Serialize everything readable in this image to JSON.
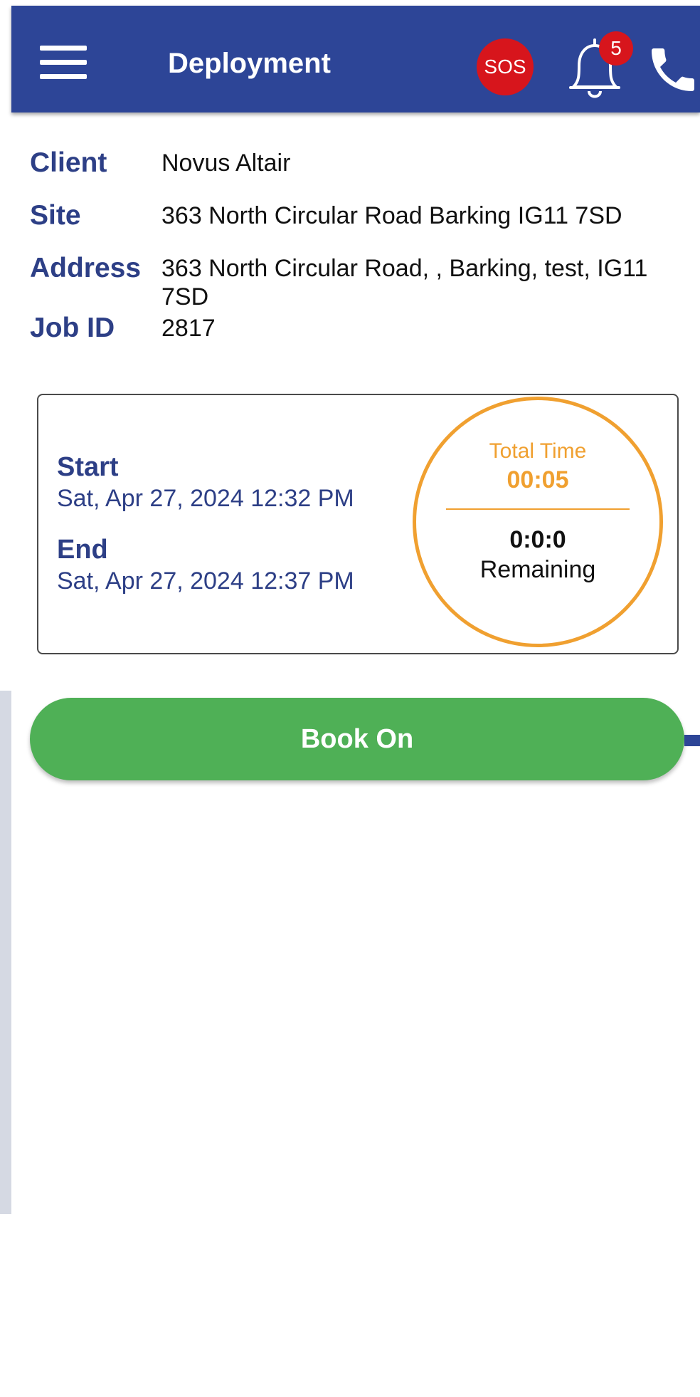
{
  "header": {
    "title": "Deployment",
    "sos_label": "SOS",
    "notification_count": "5",
    "colors": {
      "bar": "#2d4597",
      "sos": "#d7151c"
    }
  },
  "details": {
    "client_label": "Client",
    "client_value": "Novus Altair",
    "site_label": "Site",
    "site_value": "363 North Circular Road Barking IG11 7SD",
    "address_label": "Address",
    "address_value": "363 North Circular Road, , Barking, test, IG11 7SD",
    "job_id_label": "Job ID",
    "job_id_value": "2817"
  },
  "shift": {
    "start_label": "Start",
    "start_value": "Sat, Apr 27, 2024 12:32 PM",
    "end_label": "End",
    "end_value": "Sat, Apr 27, 2024 12:37 PM",
    "total_time_label": "Total Time",
    "total_time_value": "00:05",
    "remaining_value": "0:0:0",
    "remaining_label": "Remaining",
    "accent_color": "#f0a030"
  },
  "actions": {
    "book_on_label": "Book On",
    "button_color": "#4fb056"
  },
  "icons": [
    "menu-icon",
    "bell-icon",
    "phone-icon"
  ]
}
